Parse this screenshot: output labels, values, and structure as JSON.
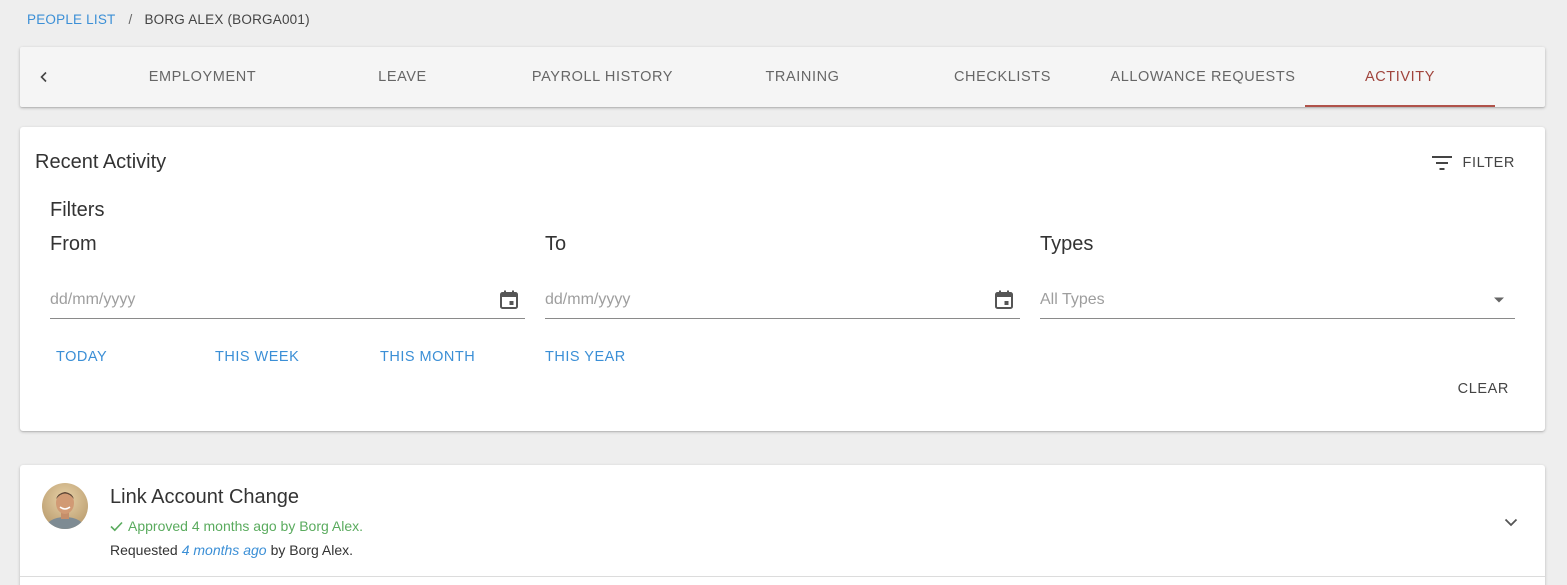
{
  "breadcrumb": {
    "parent": "PEOPLE LIST",
    "separator": "/",
    "current": "BORG ALEX (BORGA001)"
  },
  "tabs": [
    {
      "label": "EMPLOYMENT",
      "active": false
    },
    {
      "label": "LEAVE",
      "active": false
    },
    {
      "label": "PAYROLL HISTORY",
      "active": false
    },
    {
      "label": "TRAINING",
      "active": false
    },
    {
      "label": "CHECKLISTS",
      "active": false
    },
    {
      "label": "ALLOWANCE REQUESTS",
      "active": false
    },
    {
      "label": "ACTIVITY",
      "active": true
    }
  ],
  "activity": {
    "title": "Recent Activity",
    "filter_label": "FILTER",
    "filters_heading": "Filters",
    "from": {
      "label": "From",
      "placeholder": "dd/mm/yyyy"
    },
    "to": {
      "label": "To",
      "placeholder": "dd/mm/yyyy"
    },
    "types": {
      "label": "Types",
      "selected": "All Types"
    },
    "quick": [
      "TODAY",
      "THIS WEEK",
      "THIS MONTH",
      "THIS YEAR"
    ],
    "clear_label": "CLEAR"
  },
  "items": [
    {
      "title": "Link Account Change",
      "status": "Approved 4 months ago by Borg Alex.",
      "requested_prefix": "Requested",
      "requested_when": "4 months ago",
      "requested_suffix": "by Borg Alex."
    }
  ],
  "colors": {
    "accent_blue": "#3b8fd6",
    "active_tab": "#a0443c",
    "approved_green": "#5aab5e",
    "background": "#eeeeee"
  }
}
